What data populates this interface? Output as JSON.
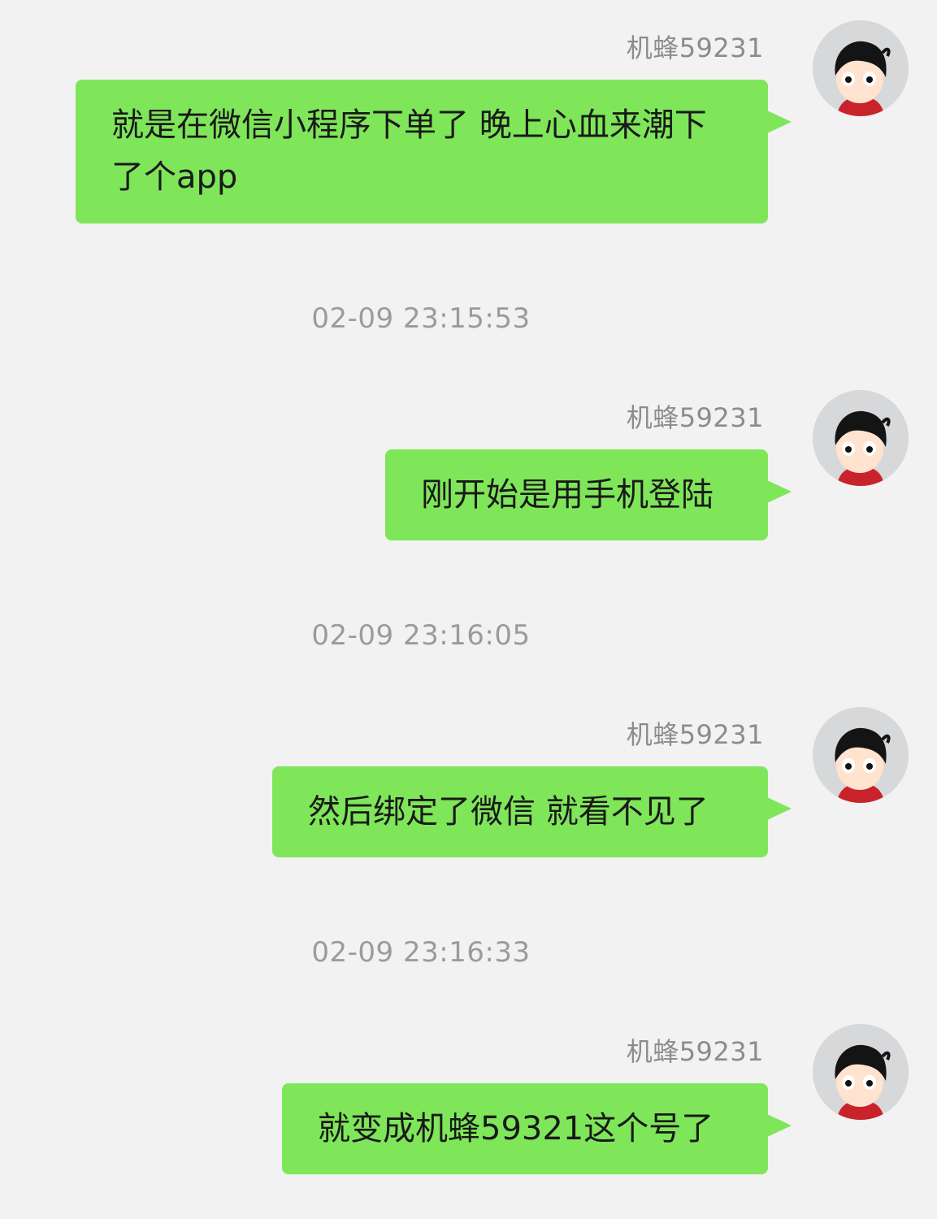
{
  "chat": {
    "messages": [
      {
        "sender": "机蜂59231",
        "text": "就是在微信小程序下单了 晚上心血来潮下了个app",
        "avatar": "boy-avatar-icon"
      },
      {
        "timestamp": "02-09 23:15:53"
      },
      {
        "sender": "机蜂59231",
        "text": "刚开始是用手机登陆",
        "avatar": "boy-avatar-icon"
      },
      {
        "timestamp": "02-09 23:16:05"
      },
      {
        "sender": "机蜂59231",
        "text": "然后绑定了微信 就看不见了",
        "avatar": "boy-avatar-icon"
      },
      {
        "timestamp": "02-09 23:16:33"
      },
      {
        "sender": "机蜂59231",
        "text": "就变成机蜂59321这个号了",
        "avatar": "boy-avatar-icon"
      }
    ]
  },
  "colors": {
    "background": "#f2f2f2",
    "bubble": "#7fe65a",
    "text": "#191919",
    "meta_text": "#8c8c8c"
  }
}
